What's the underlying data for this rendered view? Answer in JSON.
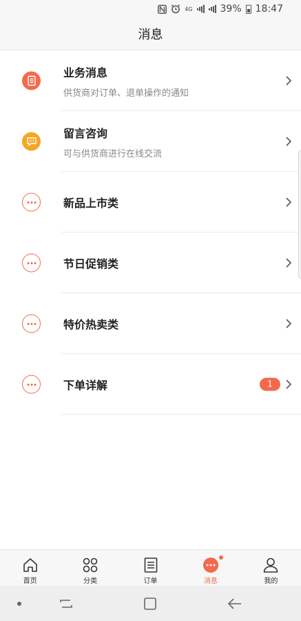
{
  "status_bar": {
    "network": "4G",
    "battery": "39%",
    "time": "18:47"
  },
  "header": {
    "title": "消息"
  },
  "messages": [
    {
      "label": "业务消息",
      "sub": "供货商对订单、退单操作的通知",
      "icon": "document-icon",
      "badge": ""
    },
    {
      "label": "留言咨询",
      "sub": "可与供货商进行在线交流",
      "icon": "chat-bubble-icon",
      "badge": ""
    },
    {
      "label": "新品上市类",
      "sub": "",
      "icon": "more-dots-icon",
      "badge": ""
    },
    {
      "label": "节日促销类",
      "sub": "",
      "icon": "more-dots-icon",
      "badge": ""
    },
    {
      "label": "特价热卖类",
      "sub": "",
      "icon": "more-dots-icon",
      "badge": ""
    },
    {
      "label": "下单详解",
      "sub": "",
      "icon": "more-dots-icon",
      "badge": "1"
    }
  ],
  "tabs": [
    {
      "label": "首页",
      "icon": "home-icon"
    },
    {
      "label": "分类",
      "icon": "grid-circles-icon"
    },
    {
      "label": "订单",
      "icon": "order-list-icon"
    },
    {
      "label": "消息",
      "icon": "message-icon",
      "active": true
    },
    {
      "label": "我的",
      "icon": "user-icon"
    }
  ],
  "colors": {
    "accent": "#f26a4b",
    "orange": "#f5a623"
  }
}
